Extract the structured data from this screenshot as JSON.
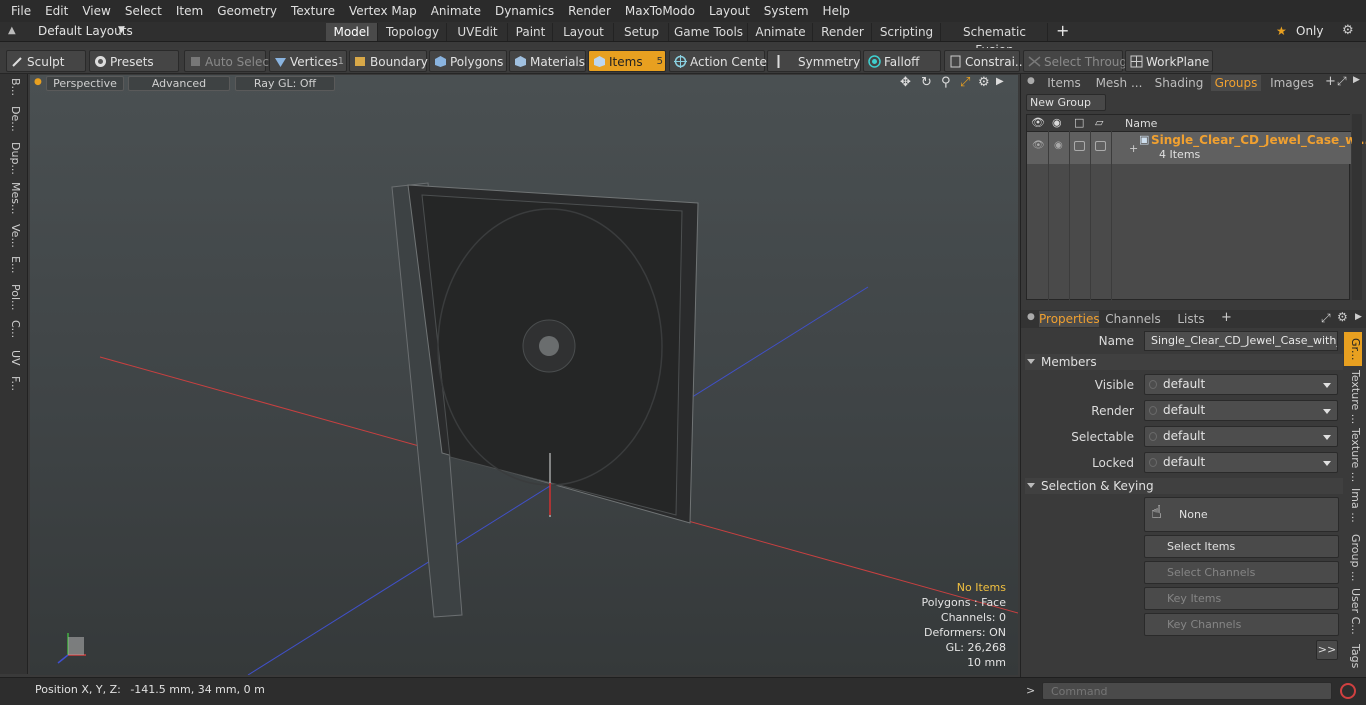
{
  "menu": [
    "File",
    "Edit",
    "View",
    "Select",
    "Item",
    "Geometry",
    "Texture",
    "Vertex Map",
    "Animate",
    "Dynamics",
    "Render",
    "MaxToModo",
    "Layout",
    "System",
    "Help"
  ],
  "layout_selector": "Default Layouts",
  "layout_tabs": [
    {
      "label": "Model",
      "active": true
    },
    {
      "label": "Topology"
    },
    {
      "label": "UVEdit"
    },
    {
      "label": "Paint"
    },
    {
      "label": "Layout"
    },
    {
      "label": "Setup"
    },
    {
      "label": "Game Tools"
    },
    {
      "label": "Animate"
    },
    {
      "label": "Render"
    },
    {
      "label": "Scripting"
    },
    {
      "label": "Schematic Fusion"
    }
  ],
  "only_label": "Only",
  "toolbar": {
    "sculpt": "Sculpt",
    "presets": "Presets",
    "auto_select": "Auto Select",
    "vertices": "Vertices",
    "vertices_count": "1",
    "boundary": "Boundary",
    "polygons": "Polygons",
    "materials": "Materials",
    "items": "Items",
    "items_count": "5",
    "action_center": "Action Center",
    "symmetry": "Symmetry",
    "falloff": "Falloff",
    "constraints": "Constrai...",
    "select_through": "Select Through",
    "workplane": "WorkPlane"
  },
  "left_tabs": [
    "B...",
    "De...",
    "Dup...",
    "Mes...",
    "Ve...",
    "E...",
    "Pol...",
    "C...",
    "UV",
    "F..."
  ],
  "viewport": {
    "perspective": "Perspective",
    "advanced": "Advanced",
    "raygl": "Ray GL: Off",
    "stats": {
      "no_items": "No Items",
      "polygons": "Polygons : Face",
      "channels": "Channels: 0",
      "deformers": "Deformers: ON",
      "gl": "GL: 26,268",
      "scale": "10 mm"
    }
  },
  "status": {
    "position_label": "Position X, Y, Z:",
    "position_value": "-141.5 mm, 34 mm, 0 m"
  },
  "panel_tabs": [
    "Items",
    "Mesh ...",
    "Shading",
    "Groups",
    "Images"
  ],
  "panel_active_tab": "Groups",
  "new_group": "New Group",
  "groups_header": "Name",
  "group": {
    "name": "Single_Clear_CD_Jewel_Case_w...",
    "count": "4 Items"
  },
  "prop_tabs": [
    "Properties",
    "Channels",
    "Lists"
  ],
  "properties": {
    "name_label": "Name",
    "name_value": "Single_Clear_CD_Jewel_Case_with_Bl",
    "members": "Members",
    "visible_label": "Visible",
    "visible": "default",
    "render_label": "Render",
    "render": "default",
    "selectable_label": "Selectable",
    "selectable": "default",
    "locked_label": "Locked",
    "locked": "default",
    "selection_keying": "Selection & Keying",
    "none": "None",
    "select_items": "Select Items",
    "select_channels": "Select Channels",
    "key_items": "Key Items",
    "key_channels": "Key Channels",
    "more": ">>"
  },
  "right_tabs": [
    "Gr...",
    "Texture ...",
    "Texture ...",
    "Ima ...",
    "Group ...",
    "User C...",
    "Tags"
  ],
  "command_placeholder": "Command",
  "colors": {
    "accent": "#e8a020",
    "group_name": "#f0a030",
    "axis_x": "#d04040",
    "axis_z": "#4050c0"
  }
}
